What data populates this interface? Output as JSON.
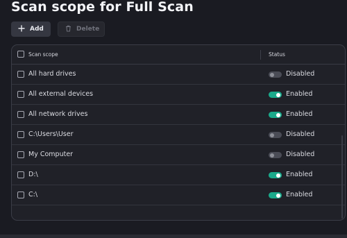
{
  "page": {
    "title": "Scan scope for Full Scan"
  },
  "toolbar": {
    "add_label": "Add",
    "add_icon": "plus-icon",
    "delete_label": "Delete",
    "delete_icon": "trash-icon",
    "delete_enabled": false
  },
  "table": {
    "columns": {
      "scope": "Scan scope",
      "status": "Status"
    },
    "rows": [
      {
        "scope": "All hard drives",
        "enabled": false,
        "status": "Disabled"
      },
      {
        "scope": "All external devices",
        "enabled": true,
        "status": "Enabled"
      },
      {
        "scope": "All network drives",
        "enabled": true,
        "status": "Enabled"
      },
      {
        "scope": "C:\\Users\\User",
        "enabled": false,
        "status": "Disabled"
      },
      {
        "scope": "My Computer",
        "enabled": false,
        "status": "Disabled"
      },
      {
        "scope": "D:\\",
        "enabled": true,
        "status": "Enabled"
      },
      {
        "scope": "C:\\",
        "enabled": true,
        "status": "Enabled"
      }
    ]
  },
  "colors": {
    "background": "#1a1b22",
    "panel": "#202128",
    "toggle_on": "#1aa98b",
    "toggle_off": "#4a4c56"
  }
}
